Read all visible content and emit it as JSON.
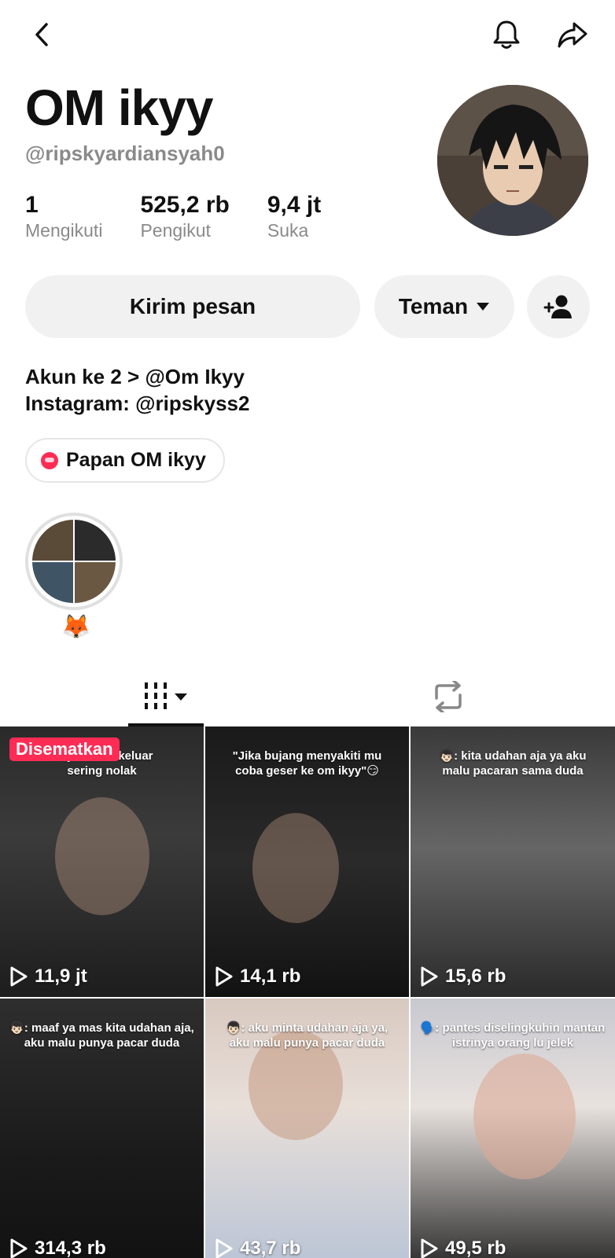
{
  "profile": {
    "name": "OM ikyy",
    "handle": "@ripskyardiansyah0",
    "stats": [
      {
        "value": "1",
        "label": "Mengikuti"
      },
      {
        "value": "525,2 rb",
        "label": "Pengikut"
      },
      {
        "value": "9,4 jt",
        "label": "Suka"
      }
    ],
    "bio": [
      "Akun ke 2 > @Om Ikyy",
      "Instagram: @ripskyss2"
    ]
  },
  "actions": {
    "message_label": "Kirim pesan",
    "friend_label": "Teman"
  },
  "board": {
    "label": "Papan OM ikyy"
  },
  "highlight": {
    "label": "🦊"
  },
  "tabs": {
    "videos_icon": "grid-icon",
    "reposts_icon": "repost-icon"
  },
  "videos": [
    {
      "caption": "diajak main keluar\nsering nolak",
      "views": "11,9 jt",
      "pinned_label": "Disematkan"
    },
    {
      "caption": "\"Jika bujang menyakiti mu\ncoba geser ke om ikyy\"😏",
      "views": "14,1 rb"
    },
    {
      "caption": "👦🏻: kita udahan aja ya aku\nmalu pacaran sama duda",
      "views": "15,6 rb"
    },
    {
      "caption": "👦🏻: maaf ya mas kita udahan aja,\naku malu punya pacar duda",
      "views": "314,3 rb"
    },
    {
      "caption": "👦🏻: aku minta udahan aja ya,\naku malu punya pacar duda",
      "views": "43,7 rb"
    },
    {
      "caption": "🗣️: pantes diselingkuhin mantan\nistrinya orang lu jelek",
      "views": "49,5 rb"
    }
  ],
  "colors": {
    "accent": "#fe2c55",
    "muted": "#8a8a8a",
    "button_bg": "#f1f1f2"
  }
}
